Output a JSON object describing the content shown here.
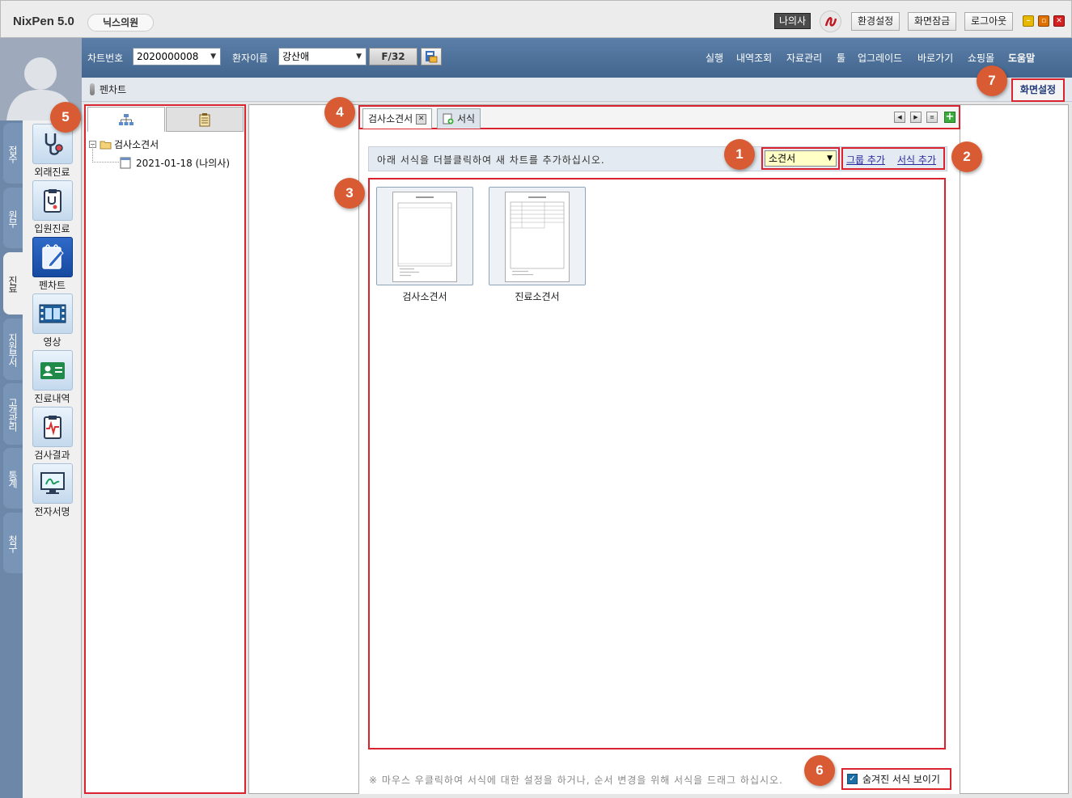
{
  "app": {
    "name": "NixPen 5.0",
    "clinic": "닉스의원"
  },
  "titlebar": {
    "user": "나의사",
    "buttons": [
      "환경설정",
      "화면잠금",
      "로그아웃"
    ]
  },
  "nav": {
    "chart_no_label": "차트번호",
    "chart_no_value": "2020000008",
    "patient_label": "환자이름",
    "patient_value": "강산애",
    "f_count": "F/32",
    "menu": [
      "실행",
      "내역조회",
      "자료관리",
      "툴",
      "업그레이드",
      "바로가기",
      "쇼핑몰",
      "도움말"
    ]
  },
  "vertical_tabs": [
    "접수",
    "원무",
    "진료",
    "지원부서",
    "고객관리",
    "통계",
    "청구"
  ],
  "sidebar_icons": [
    "외래진료",
    "입원진료",
    "펜차트",
    "영상",
    "진료내역",
    "검사결과",
    "전자서명"
  ],
  "breadcrumb": "펜차트",
  "screen_setting": "화면설정",
  "tree": {
    "folder": "검사소견서",
    "entry": "2021-01-18 (나의사)"
  },
  "doc_tabs": [
    "검사소견서",
    "서식"
  ],
  "info_text": "아래 서식을 더블클릭하여 새 차트를 추가하십시오.",
  "category_select": "소견서",
  "links": {
    "add_group": "그룹 추가",
    "add_form": "서식 추가"
  },
  "forms": [
    "검사소견서",
    "진료소견서"
  ],
  "footer_note": "※ 마우스 우클릭하여 서식에 대한 설정을 하거나, 순서 변경을 위해 서식을 드래그 하십시오.",
  "show_hidden_label": "숨겨진 서식 보이기",
  "callouts": [
    "1",
    "2",
    "3",
    "4",
    "5",
    "6",
    "7"
  ],
  "colors": {
    "accent_red": "#d9232e",
    "callout": "#d85b34",
    "nav_blue": "#4f739c"
  }
}
